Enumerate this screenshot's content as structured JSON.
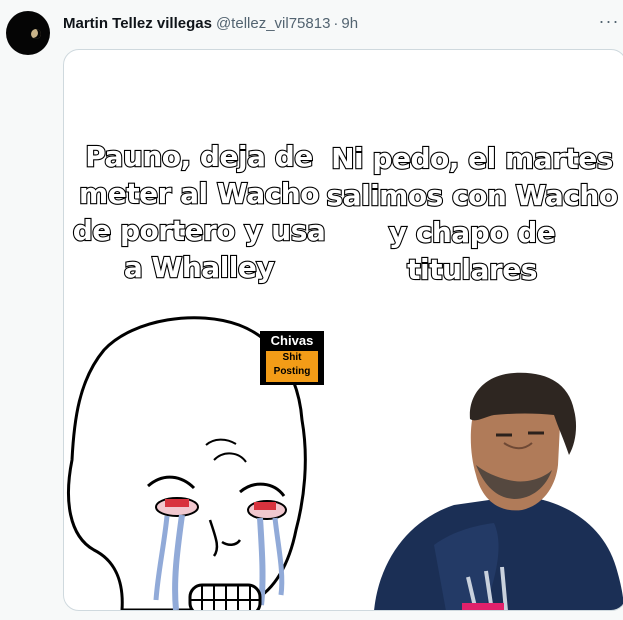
{
  "tweet": {
    "author_name": "Martin Tellez villegas",
    "author_handle": "@tellez_vil75813",
    "separator": "·",
    "time_ago": "9h",
    "more_icon": "more-horizontal-icon"
  },
  "meme": {
    "left_text": [
      "Pauno, deja de",
      "meter al Wacho",
      "de portero y usa",
      "a Whalley"
    ],
    "right_text": [
      "Ni pedo, el martes",
      "salimos con Wacho",
      "y chapo de",
      "titulares"
    ],
    "brand": {
      "line1": "Chivas",
      "line2": "Shit",
      "line3": "Posting"
    }
  }
}
